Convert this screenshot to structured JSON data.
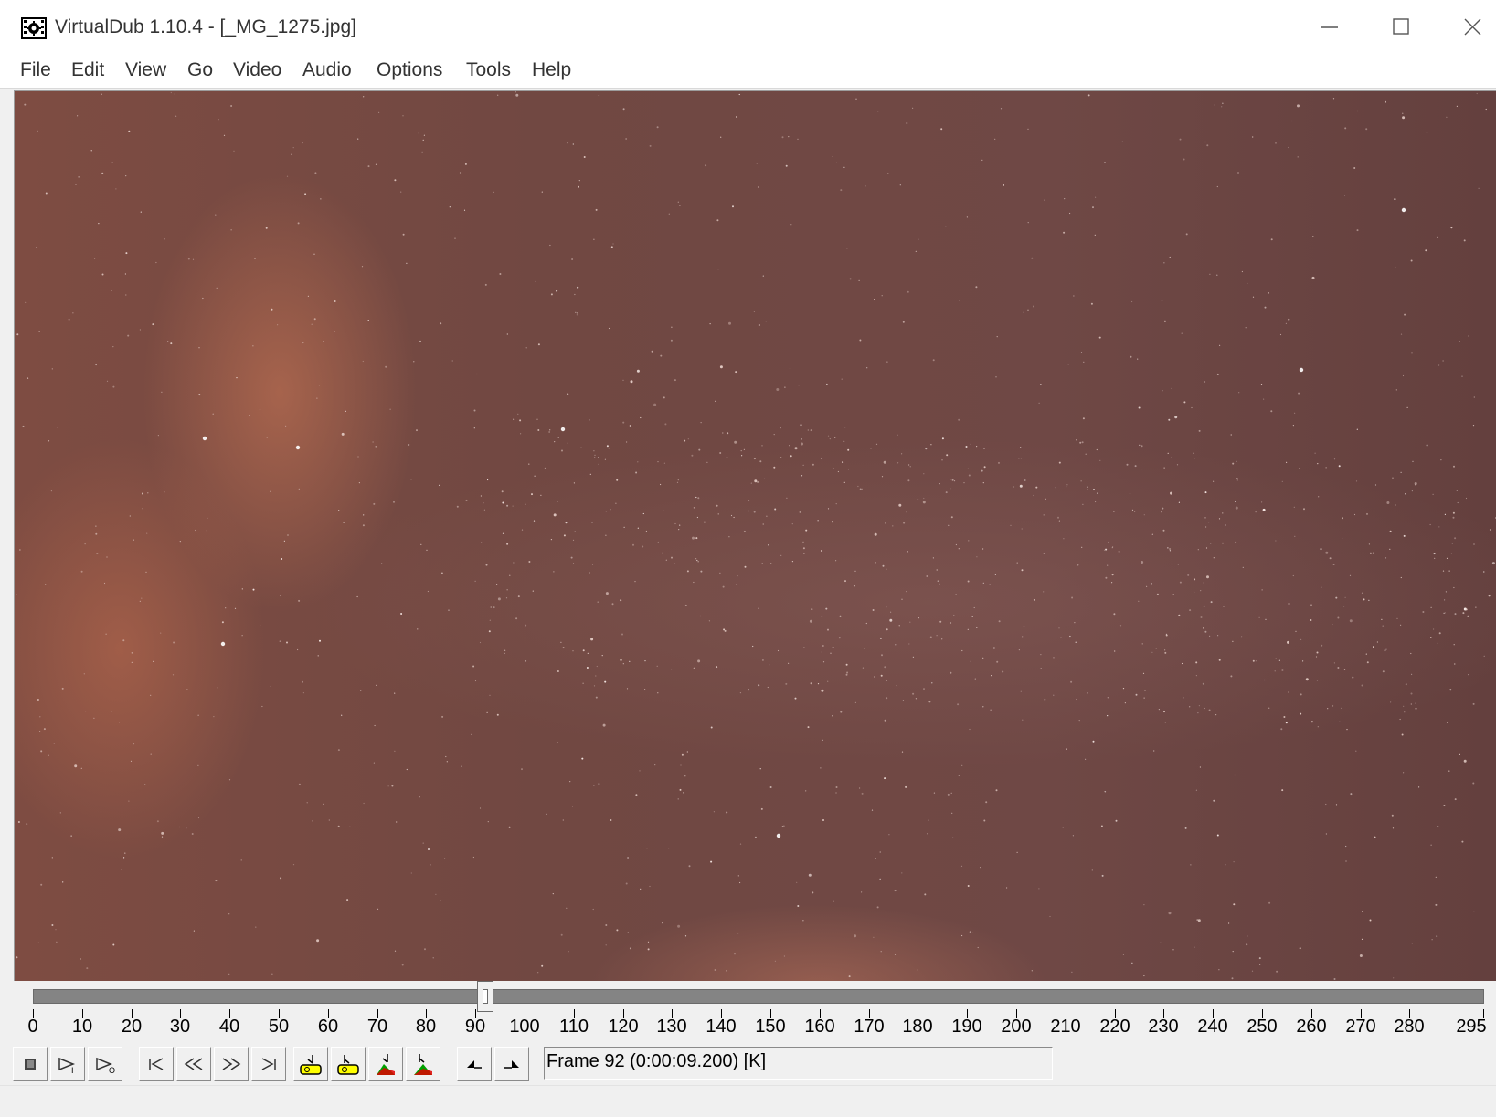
{
  "window": {
    "title": "VirtualDub 1.10.4 - [_MG_1275.jpg]",
    "icon": "virtualdub-film-gear-icon"
  },
  "menu": [
    "File",
    "Edit",
    "View",
    "Go",
    "Video",
    "Audio",
    "Options",
    "Tools",
    "Help"
  ],
  "timeline": {
    "max_frame": 295,
    "current_frame": 92,
    "tick_labels": [
      "0",
      "10",
      "20",
      "30",
      "40",
      "50",
      "60",
      "70",
      "80",
      "90",
      "100",
      "110",
      "120",
      "130",
      "140",
      "150",
      "160",
      "170",
      "180",
      "190",
      "200",
      "210",
      "220",
      "230",
      "240",
      "250",
      "260",
      "270",
      "280",
      "295"
    ]
  },
  "toolbar": {
    "buttons": [
      {
        "name": "stop",
        "icon": "stop-icon"
      },
      {
        "name": "play-input",
        "icon": "play-input-icon"
      },
      {
        "name": "play-output",
        "icon": "play-output-icon"
      },
      {
        "name": "go-start",
        "icon": "go-start-icon"
      },
      {
        "name": "prev-frame",
        "icon": "step-back-icon"
      },
      {
        "name": "next-frame",
        "icon": "step-forward-icon"
      },
      {
        "name": "go-end",
        "icon": "go-end-icon"
      },
      {
        "name": "prev-keyframe",
        "icon": "key-prev-icon"
      },
      {
        "name": "next-keyframe",
        "icon": "key-next-icon"
      },
      {
        "name": "prev-scene",
        "icon": "scene-prev-icon"
      },
      {
        "name": "next-scene",
        "icon": "scene-next-icon"
      },
      {
        "name": "mark-in",
        "icon": "mark-in-icon"
      },
      {
        "name": "mark-out",
        "icon": "mark-out-icon"
      }
    ]
  },
  "frame_info": "Frame 92 (0:00:09.200) [K]",
  "colors": {
    "sky": "#714842",
    "glow": "#cd7855",
    "track": "#848484",
    "key_yellow": "#ffff00",
    "scene_green": "#00a000",
    "scene_red": "#e00000"
  }
}
